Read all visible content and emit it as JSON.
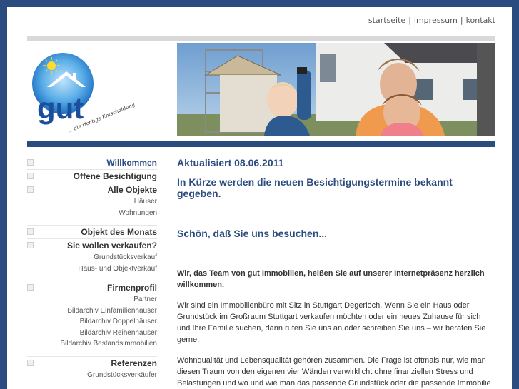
{
  "topnav": {
    "items": [
      "startseite",
      "impressum",
      "kontakt"
    ],
    "separator": "|"
  },
  "logo": {
    "text": "gut",
    "tagline": "... die richtige Entscheidung"
  },
  "sidenav": {
    "items": [
      {
        "label": "Willkommen",
        "sub": []
      },
      {
        "label": "Offene Besichtigung",
        "sub": []
      },
      {
        "label": "Alle Objekte",
        "sub": [
          "Häuser",
          "Wohnungen"
        ]
      },
      {
        "label": "Objekt des Monats",
        "sub": []
      },
      {
        "label": "Sie wollen verkaufen?",
        "sub": [
          "Grundstücksverkauf",
          "Haus- und Objektverkauf"
        ]
      },
      {
        "label": "Firmenprofil",
        "sub": [
          "Partner",
          "Bildarchiv Einfamilienhäuser",
          "Bildarchiv Doppelhäuser",
          "Bildarchiv Reihenhäuser",
          "Bildarchiv Bestandsimmobilien"
        ]
      },
      {
        "label": "Referenzen",
        "sub": [
          "Grundstücksverkäufer"
        ]
      }
    ]
  },
  "content": {
    "updated": "Aktualisiert 08.06.2011",
    "notice": "In Kürze werden die neuen Besichtigungstermine bekannt gegeben.",
    "greeting": "Schön, daß Sie uns besuchen...",
    "intro": "Wir, das Team von gut Immobilien, heißen Sie auf unserer Internetpräsenz herzlich willkommen.",
    "para1": "Wir sind ein Immobilienbüro mit Sitz in Stuttgart Degerloch. Wenn Sie ein Haus oder Grundstück im Großraum Stuttgart verkaufen möchten oder ein neues Zuhause für sich und Ihre Familie suchen, dann rufen Sie uns an oder schreiben Sie uns – wir beraten Sie gerne.",
    "para2": "Wohnqualität und Lebensqualität gehören zusammen. Die Frage ist oftmals nur, wie man diesen Traum von den eigenen vier Wänden verwirklicht ohne finanziellen Stress und Belastungen und wo und wie man das passende Grundstück oder die passende Immobilie"
  },
  "colors": {
    "brand_blue": "#2b4c7e",
    "logo_blue": "#2a7fd0",
    "background": "#2b4c7e"
  }
}
